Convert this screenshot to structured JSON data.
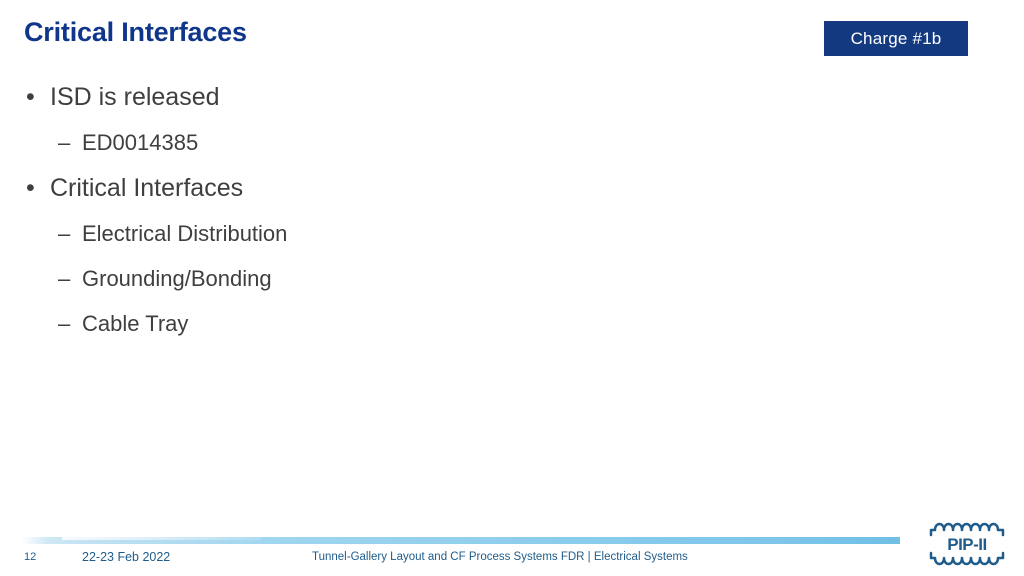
{
  "slide": {
    "title": "Critical Interfaces",
    "badge": {
      "label": "Charge #1b"
    },
    "bullets": [
      {
        "level": 1,
        "marker": "•",
        "text": "ISD is released"
      },
      {
        "level": 2,
        "marker": "–",
        "text": "ED0014385"
      },
      {
        "level": 1,
        "marker": "•",
        "text": "Critical Interfaces"
      },
      {
        "level": 2,
        "marker": "–",
        "text": "Electrical Distribution"
      },
      {
        "level": 2,
        "marker": "–",
        "text": "Grounding/Bonding"
      },
      {
        "level": 2,
        "marker": "–",
        "text": "Cable Tray"
      }
    ],
    "footer": {
      "page_number": "12",
      "date": "22-23 Feb 2022",
      "center_text": "Tunnel-Gallery Layout and CF Process Systems FDR | Electrical Systems"
    },
    "logo": {
      "name": "pip-ii-logo",
      "text": "PIP-II"
    },
    "colors": {
      "title_blue": "#10368C",
      "badge_blue": "#133A81",
      "body_gray": "#3F3F3F",
      "footer_blue": "#1F5C8B",
      "rule_blue": "#8CCDEC",
      "background": "#FFFFFF"
    }
  }
}
